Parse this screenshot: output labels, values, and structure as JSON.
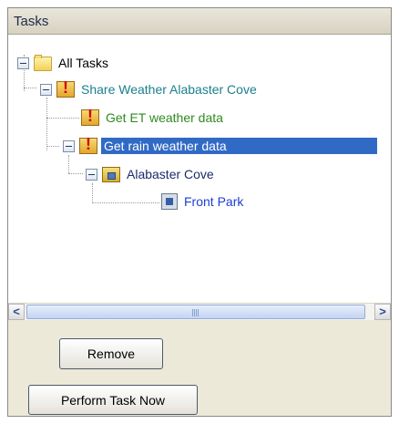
{
  "panel": {
    "title": "Tasks"
  },
  "tree": {
    "nodes": [
      {
        "label": "All Tasks"
      },
      {
        "label": "Share Weather Alabaster Cove"
      },
      {
        "label": "Get ET weather data"
      },
      {
        "label": "Get rain weather data"
      },
      {
        "label": "Alabaster Cove"
      },
      {
        "label": "Front Park"
      }
    ],
    "selected_index": 3
  },
  "scrollbar": {
    "left_arrow": "<",
    "right_arrow": ">"
  },
  "buttons": {
    "remove": "Remove",
    "perform": "Perform Task Now"
  },
  "colors": {
    "selection": "#316ac5",
    "teal_text": "#1a7f8c",
    "green_text": "#2f8a1e",
    "blue_text": "#1d3dd6"
  }
}
